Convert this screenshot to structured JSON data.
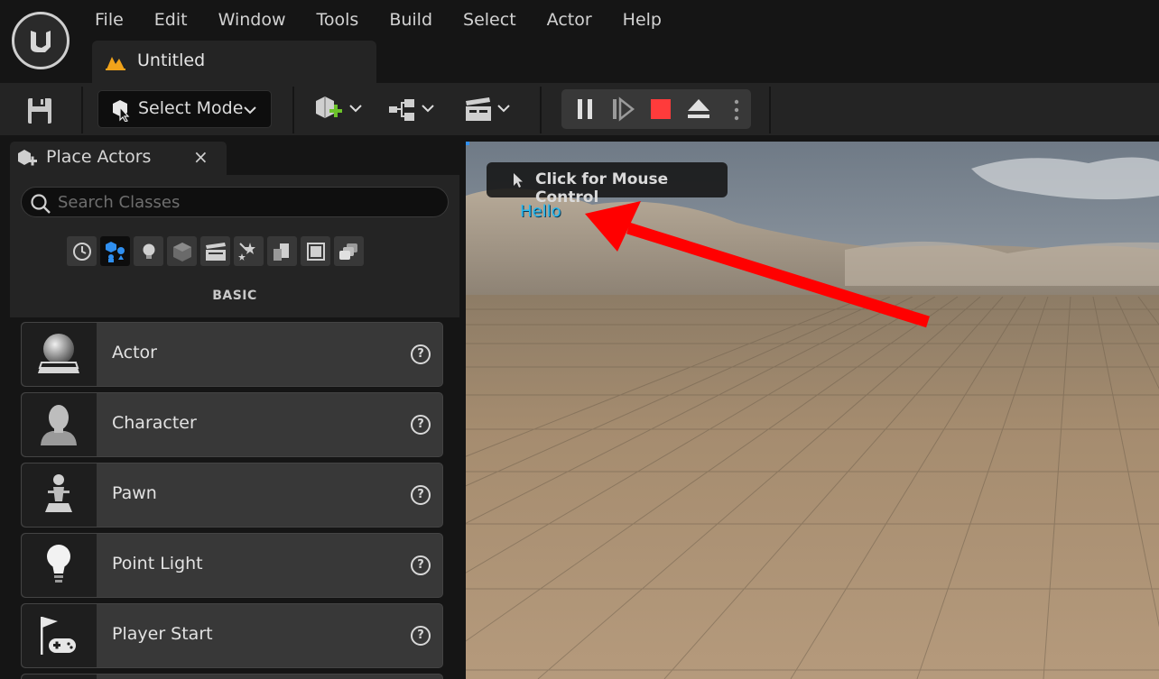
{
  "menu": [
    "File",
    "Edit",
    "Window",
    "Tools",
    "Build",
    "Select",
    "Actor",
    "Help"
  ],
  "document_tab": {
    "title": "Untitled",
    "icon": "level-icon"
  },
  "toolbar": {
    "save_icon": "save-icon",
    "mode_label": "Select Mode",
    "buttons": [
      "add-actor-icon",
      "blueprint-icon",
      "cinematics-icon"
    ],
    "play_controls": [
      "pause-icon",
      "step-icon",
      "stop-icon",
      "eject-icon",
      "more-options-icon"
    ]
  },
  "place_actors": {
    "tab_label": "Place Actors",
    "close_label": "×",
    "search_placeholder": "Search Classes",
    "categories": [
      "recent-icon",
      "basic-icon",
      "lights-icon",
      "shapes-icon",
      "cinematic-icon",
      "visual-effects-icon",
      "geometry-icon",
      "volumes-icon",
      "all-classes-icon"
    ],
    "active_category": "BASIC",
    "items": [
      {
        "label": "Actor",
        "icon": "actor-sphere-icon"
      },
      {
        "label": "Character",
        "icon": "character-icon"
      },
      {
        "label": "Pawn",
        "icon": "pawn-icon"
      },
      {
        "label": "Point Light",
        "icon": "point-light-icon"
      },
      {
        "label": "Player Start",
        "icon": "player-start-icon"
      }
    ],
    "help_glyph": "?"
  },
  "viewport": {
    "mouse_control_label": "Click for Mouse Control",
    "hello_text": "Hello",
    "annotation": "red-arrow",
    "colors": {
      "hello": "#29b9f0",
      "arrow": "#ff0000",
      "stop": "#ff3b3b"
    }
  }
}
